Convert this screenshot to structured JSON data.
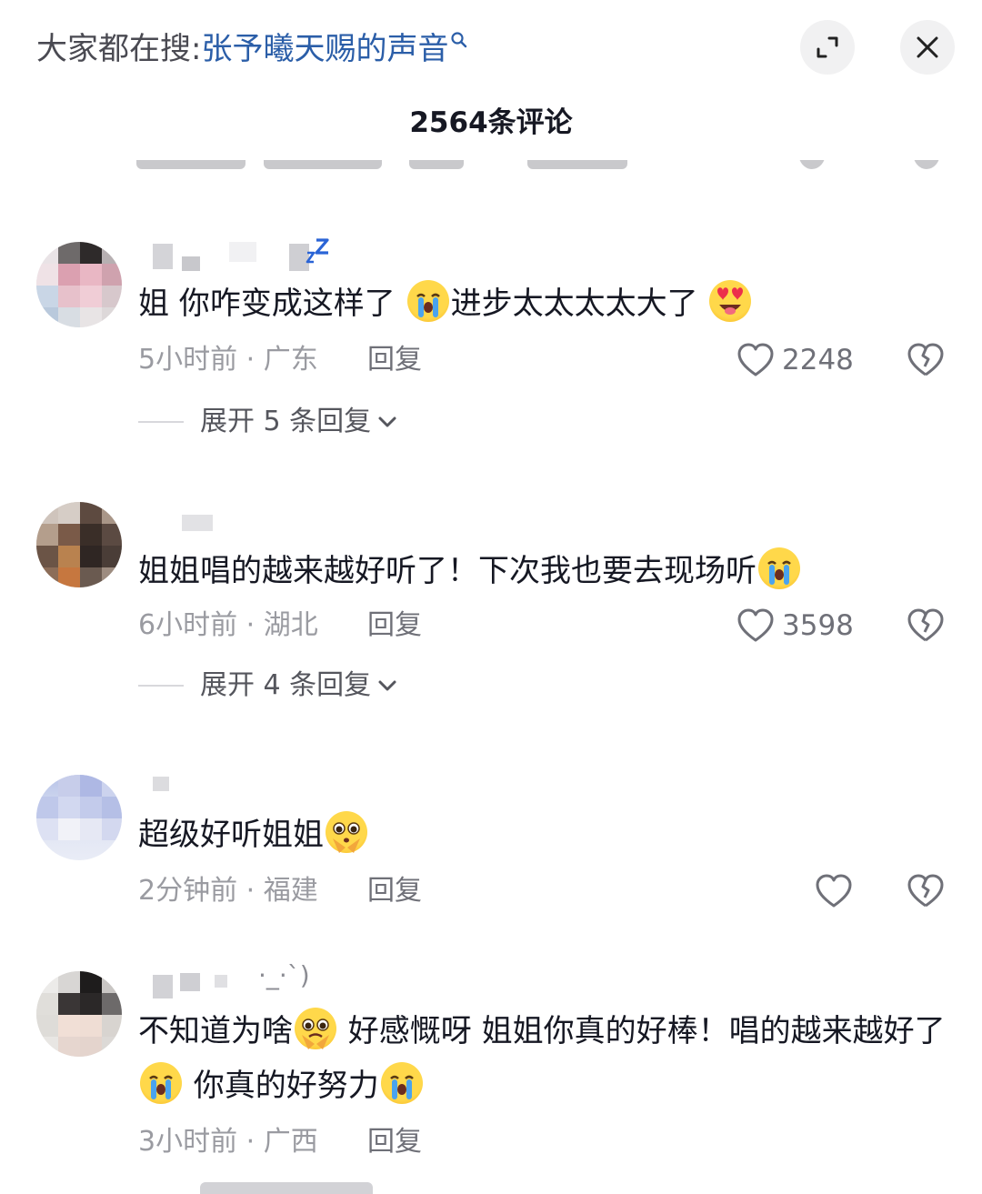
{
  "search": {
    "prefix": "大家都在搜:",
    "term": "张予曦天赐的声音"
  },
  "header": {
    "title": "2564条评论"
  },
  "comments": [
    {
      "text_a": "姐 你咋变成这样了",
      "text_b": "进步太太太太大了",
      "time_location": "5小时前 · 广东",
      "reply_label": "回复",
      "likes": "2248",
      "expand_label": "展开 5 条回复"
    },
    {
      "text_a": "姐姐唱的越来越好听了！下次我也要去现场听",
      "time_location": "6小时前 · 湖北",
      "reply_label": "回复",
      "likes": "3598",
      "expand_label": "展开 4 条回复"
    },
    {
      "text_a": "超级好听姐姐",
      "time_location": "2分钟前 · 福建",
      "reply_label": "回复",
      "likes": ""
    },
    {
      "username_fragment": "·_·`)",
      "text_a": "不知道为啥",
      "text_b": " 好感慨呀 姐姐你真的好棒！唱的越来越好了",
      "text_c": " 你真的好努力",
      "time_location": "3小时前 · 广西",
      "reply_label": "回复"
    }
  ],
  "icons": {
    "search": "search-icon",
    "expand": "expand-icon",
    "close": "close-icon",
    "like": "heart-outline-icon",
    "dislike": "broken-heart-icon",
    "chevron": "chevron-down-icon"
  },
  "colors": {
    "text": "#161823",
    "link": "#2b5ea8",
    "meta": "#9a9ba1",
    "button_bg": "#f1f1f2"
  }
}
